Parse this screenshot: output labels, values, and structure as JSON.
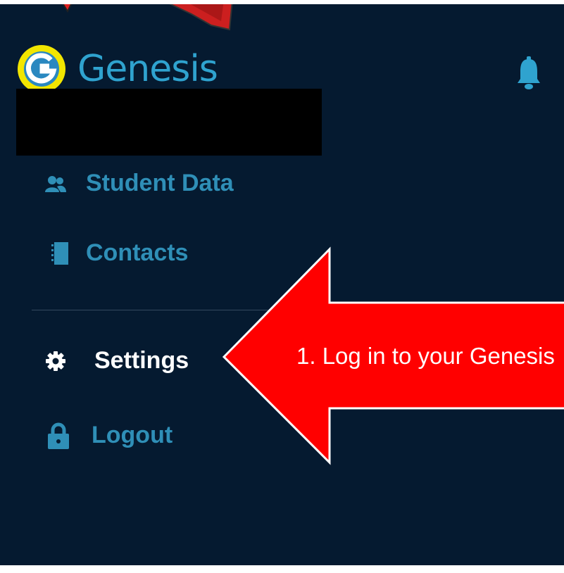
{
  "app": {
    "logo_text": "Genesis"
  },
  "nav": {
    "items": [
      {
        "label": "Student Data",
        "icon": "users-icon"
      },
      {
        "label": "Contacts",
        "icon": "address-book-icon"
      },
      {
        "label": "Settings",
        "icon": "gear-icon"
      },
      {
        "label": "Logout",
        "icon": "lock-icon"
      }
    ]
  },
  "header": {
    "notification_icon": "bell-icon"
  },
  "annotation": {
    "text": "1. Log in to your Genesis",
    "arrow_color": "#ff0000"
  },
  "colors": {
    "background": "#051a30",
    "accent": "#2f8fb7",
    "logo_ring": "#f2e600",
    "active": "#ffffff"
  }
}
